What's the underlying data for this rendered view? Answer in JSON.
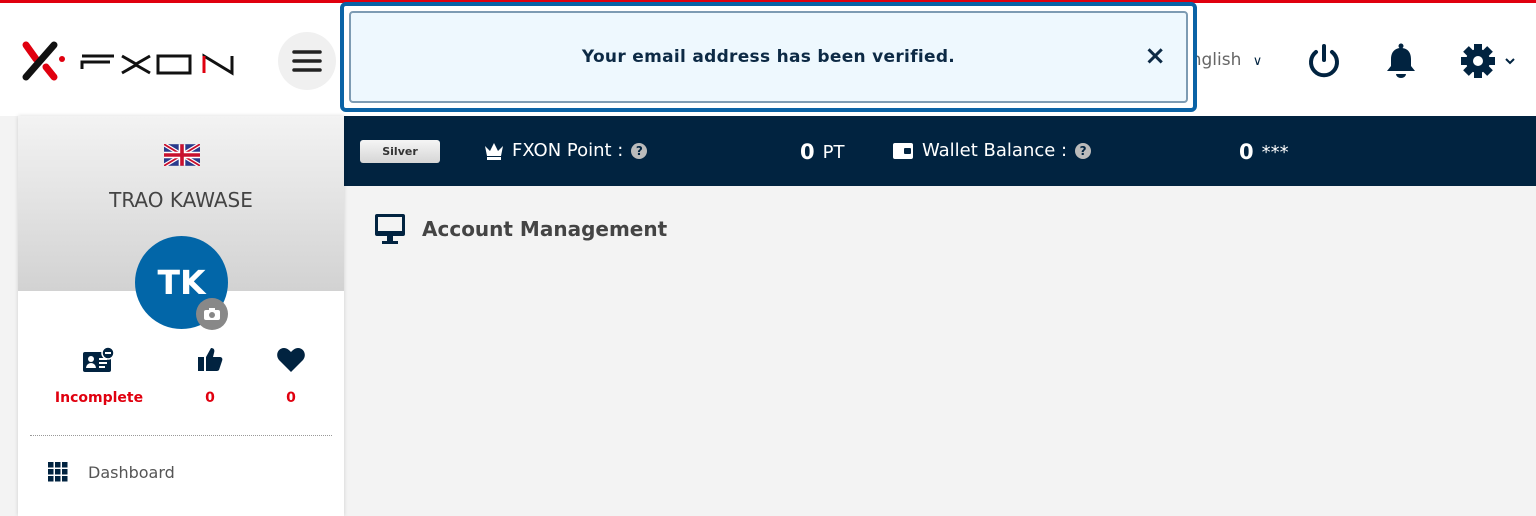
{
  "header": {
    "brand": "FXON",
    "language": "English"
  },
  "alert": {
    "message": "Your email address has been verified.",
    "close": "×"
  },
  "navbar": {
    "rank": "Silver",
    "point_label": "FXON Point :",
    "point_value": "0",
    "point_unit": "PT",
    "wallet_label": "Wallet Balance :",
    "wallet_value": "0",
    "wallet_unit": "***",
    "help": "?"
  },
  "sidebar": {
    "user_name": "TRAO KAWASE",
    "initials": "TK",
    "stats": [
      {
        "value": "Incomplete",
        "icon": "id-card-icon"
      },
      {
        "value": "0",
        "icon": "thumbs-up-icon"
      },
      {
        "value": "0",
        "icon": "heart-icon"
      }
    ],
    "items": [
      {
        "label": "Dashboard",
        "icon": "grid-icon"
      }
    ]
  },
  "main": {
    "title": "Account Management"
  },
  "colors": {
    "accent_red": "#e0000f",
    "navy": "#012340",
    "avatar_blue": "#0266a8"
  }
}
